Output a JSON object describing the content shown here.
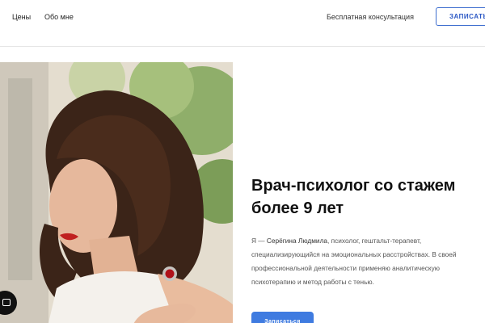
{
  "header": {
    "nav": [
      {
        "label": "Цены"
      },
      {
        "label": "Обо мне"
      }
    ],
    "consultation_link": "Бесплатная консультация",
    "signup_button": "ЗАПИСАТЬСЯ"
  },
  "hero": {
    "headline_line1": "Врач-психолог со стажем",
    "headline_line2": "более 9 лет",
    "bio_prefix": "Я — ",
    "bio_name": "Серёгина Людмила",
    "bio_rest": ", психолог, гештальт-терапевт, специализирующийся на эмоциональных расстройствах. В своей профессиональной деятельности применяю аналитическую психотерапию и метод работы с тенью.",
    "signup_button": "Записаться"
  },
  "chat_widget": {
    "icon": "chat-icon"
  }
}
